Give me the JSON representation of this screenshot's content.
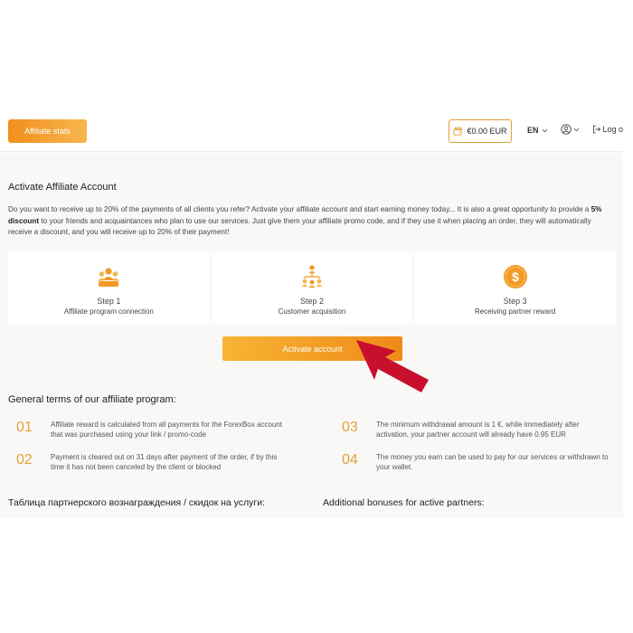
{
  "header": {
    "affiliate_stats_label": "Affiliate stats",
    "balance": "€0.00 EUR",
    "language": "EN",
    "logout_label": "Log o"
  },
  "main": {
    "title": "Activate Affiliate Account",
    "intro_part1": "Do you want to receive up to 20% of the payments of all clients you refer? Activate your affiliate account and start earning money today... It is also a great opportunity to provide a ",
    "intro_bold": "5% discount",
    "intro_part2": " to your friends and acquaintances who plan to use our services. Just give them your affiliate promo code, and if they use it when placing an order, they will automatically receive a discount, and you will receive up to 20% of their payment!",
    "steps": [
      {
        "label": "Step 1",
        "desc": "Affiliate program connection",
        "icon": "users-group-icon"
      },
      {
        "label": "Step 2",
        "desc": "Customer acquisition",
        "icon": "network-icon"
      },
      {
        "label": "Step 3",
        "desc": "Receiving partner reward",
        "icon": "dollar-coin-icon"
      }
    ],
    "activate_label": "Activate account",
    "terms_title": "General terms of our affiliate program:",
    "terms": [
      {
        "num": "01",
        "text": "Affiliate reward is calculated from all payments for the ForexBox account that was purchased using your link / promo-code"
      },
      {
        "num": "02",
        "text": "Payment is cleared out on 31 days after payment of the order, if by this time it has not been canceled by the client or blocked"
      },
      {
        "num": "03",
        "text": "The minimum withdrawal amount is 1 €, while immediately after activation, your partner account will already have 0.95 EUR"
      },
      {
        "num": "04",
        "text": "The money you earn can be used to pay for our services or withdrawn to your wallet."
      }
    ],
    "table_title": "Таблица партнерского вознаграждения / скидок на услуги:",
    "bonuses_title": "Additional bonuses for active partners:"
  },
  "colors": {
    "accent": "#f29a26",
    "accent_light": "#f7b64e",
    "number_gold": "#e3a23a",
    "arrow_red": "#c8102e"
  }
}
